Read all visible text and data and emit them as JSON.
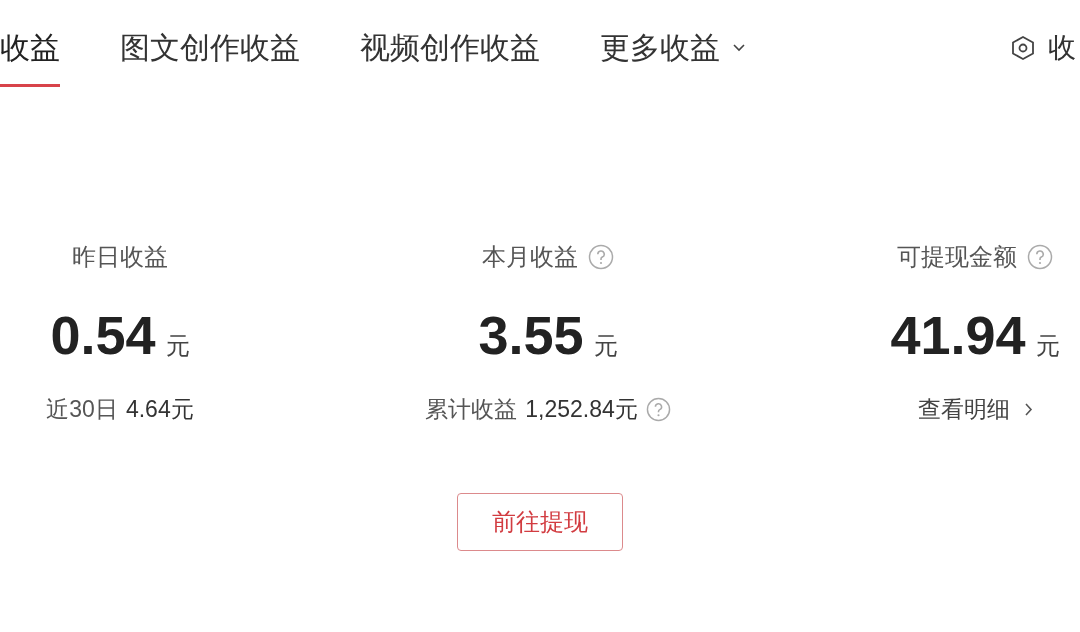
{
  "tabs": [
    {
      "label": "收益",
      "selected": true,
      "dropdown": false
    },
    {
      "label": "图文创作收益",
      "selected": false,
      "dropdown": false
    },
    {
      "label": "视频创作收益",
      "selected": false,
      "dropdown": false
    },
    {
      "label": "更多收益",
      "selected": false,
      "dropdown": true
    }
  ],
  "side_link": {
    "label": "收"
  },
  "stats": [
    {
      "label": "昨日收益",
      "help": false,
      "value": "0.54",
      "unit": "元",
      "footer": {
        "kind": "stat",
        "label": "近30日",
        "value": "4.64元",
        "help": false
      }
    },
    {
      "label": "本月收益",
      "help": true,
      "value": "3.55",
      "unit": "元",
      "footer": {
        "kind": "stat",
        "label": "累计收益",
        "value": "1,252.84元",
        "help": true
      }
    },
    {
      "label": "可提现金额",
      "help": true,
      "value": "41.94",
      "unit": "元",
      "footer": {
        "kind": "link",
        "label": "查看明细"
      }
    }
  ],
  "withdraw_button": "前往提现"
}
